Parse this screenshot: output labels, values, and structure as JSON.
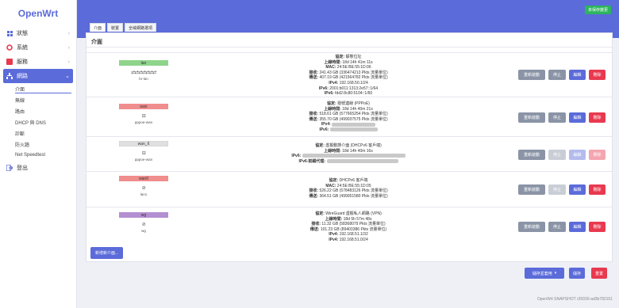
{
  "brand": "OpenWrt",
  "sidebar": {
    "items": [
      {
        "label": "狀態"
      },
      {
        "label": "系統"
      },
      {
        "label": "服務"
      },
      {
        "label": "網路"
      }
    ],
    "sub": [
      {
        "label": "介面"
      },
      {
        "label": "無線"
      },
      {
        "label": "路由"
      },
      {
        "label": "DHCP 與 DNS"
      },
      {
        "label": "診斷"
      },
      {
        "label": "防火牆"
      },
      {
        "label": "Net Speedtest"
      }
    ],
    "logout": "登出"
  },
  "unsaved": "未保存變更",
  "tabs": [
    {
      "label": "介面"
    },
    {
      "label": "裝置"
    },
    {
      "label": "全域網路選項"
    }
  ],
  "section_title": "介面",
  "colors": {
    "lan": "#8fd48b",
    "wan": "#f08d8d",
    "wan6": "#f08d8d",
    "wan_6": "#e0e0e0",
    "wg": "#b48fd1",
    "accent": "#5b6bd9",
    "danger": "#e8394f"
  },
  "interfaces": [
    {
      "name": "lan",
      "icons": "⇄⇄⇄⇄⇄⇄⇄",
      "device": "br-lan",
      "lines": [
        {
          "k": "協定:",
          "v": " 靜態位址"
        },
        {
          "k": "上線時間:",
          "v": " 18d 14h 41m 11s"
        },
        {
          "k": "MAC:",
          "v": " 24:5E:BE:55:1D:06"
        },
        {
          "k": "接收:",
          "v": " 241.43 GB (336474213 Pkts 流量單位)"
        },
        {
          "k": "傳送:",
          "v": " 407.19 GB (421564782 Pkts 流量單位)"
        },
        {
          "k": "IPv4:",
          "v": " 192.168.50.1/24"
        },
        {
          "k": "IPv6:",
          "v": " 2001:b011:1313:2e57::1/64"
        },
        {
          "k": "IPv6:",
          "v": " fdd2:8c80:5104::1/60"
        }
      ]
    },
    {
      "name": "wan",
      "icons": "⊟",
      "device": "pppoe-wan",
      "lines": [
        {
          "k": "協定:",
          "v": " 撥號連線 (PPPoE)"
        },
        {
          "k": "上線時間:",
          "v": " 18d 14h 40m 21s"
        },
        {
          "k": "接收:",
          "v": " 518.61 GB (577665254 Pkts 流量單位)"
        },
        {
          "k": "傳送:",
          "v": " 355.70 GB (499037575 Pkts 流量單位)"
        },
        {
          "k": "IPv4:",
          "v": ""
        },
        {
          "k": "IPv6:",
          "v": ""
        }
      ]
    },
    {
      "name": "wan_6",
      "icons": "⊟",
      "device": "pppoe-wan",
      "lines": [
        {
          "k": "協定:",
          "v": " 虛擬動態介面 (DHCPv6 客戶端)"
        },
        {
          "k": "上線時間:",
          "v": " 18d 14h 40m 16s"
        },
        {
          "k": "IPv6:",
          "v": ""
        },
        {
          "k": "IPv6-前綴代理:",
          "v": ""
        }
      ]
    },
    {
      "name": "wan6",
      "icons": "⊘",
      "device": "lan1",
      "lines": [
        {
          "k": "協定:",
          "v": " DHCPv6 客戶端"
        },
        {
          "k": "MAC:",
          "v": " 24:5E:BE:55:1D:05"
        },
        {
          "k": "接收:",
          "v": " 526.22 GB (578483126 Pkts 流量單位)"
        },
        {
          "k": "傳送:",
          "v": " 364.51 GB (499051580 Pkts 流量單位)"
        }
      ]
    },
    {
      "name": "wg",
      "icons": "⊘",
      "device": "wg",
      "lines": [
        {
          "k": "協定:",
          "v": " WireGuard 虛擬私人網路 (VPN)"
        },
        {
          "k": "上線時間:",
          "v": " 18d 5h 57m 48s"
        },
        {
          "k": "接收:",
          "v": " 11.32 GB (58368079 Pkts 流量單位)"
        },
        {
          "k": "傳送:",
          "v": " 101.23 GB (89403386 Pkts 流量單位)"
        },
        {
          "k": "IPv4:",
          "v": " 192.168.51.1/32"
        },
        {
          "k": "IPv4:",
          "v": " 192.168.51.0/24"
        }
      ]
    }
  ],
  "buttons": {
    "restart": "重新啟動",
    "stop": "停止",
    "edit": "編輯",
    "delete": "刪除"
  },
  "add_interface": "新增新介面...",
  "footer_buttons": {
    "save_apply": "儲存並套用",
    "save": "儲存",
    "reset": "重置"
  },
  "footer_text": "OpenWrt SNAPSHOT r26930-ad3b782161"
}
